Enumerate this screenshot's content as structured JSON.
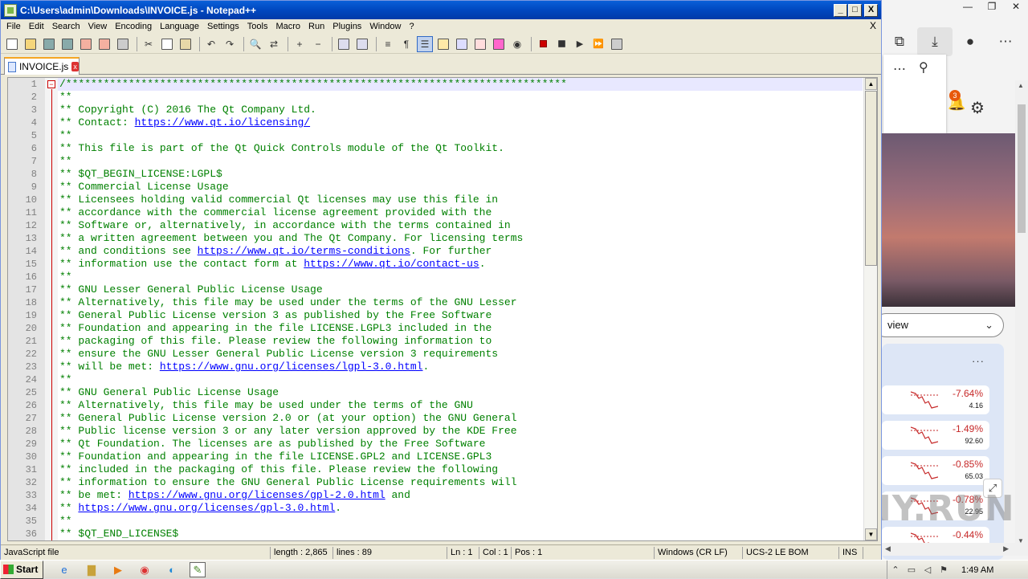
{
  "window": {
    "title": "C:\\Users\\admin\\Downloads\\INVOICE.js - Notepad++",
    "min": "_",
    "max": "□",
    "close": "X"
  },
  "menu": [
    "File",
    "Edit",
    "Search",
    "View",
    "Encoding",
    "Language",
    "Settings",
    "Tools",
    "Macro",
    "Run",
    "Plugins",
    "Window",
    "?"
  ],
  "menu_close": "X",
  "tab": {
    "label": "INVOICE.js",
    "close": "x"
  },
  "editor": {
    "lines": [
      {
        "n": "1",
        "t": "/********************************************************************************"
      },
      {
        "n": "2",
        "t": "**"
      },
      {
        "n": "3",
        "t": "** Copyright (C) 2016 The Qt Company Ltd."
      },
      {
        "n": "4",
        "t": "** Contact: ",
        "link": "https://www.qt.io/licensing/",
        "after": ""
      },
      {
        "n": "5",
        "t": "**"
      },
      {
        "n": "6",
        "t": "** This file is part of the Qt Quick Controls module of the Qt Toolkit."
      },
      {
        "n": "7",
        "t": "**"
      },
      {
        "n": "8",
        "t": "** $QT_BEGIN_LICENSE:LGPL$"
      },
      {
        "n": "9",
        "t": "** Commercial License Usage"
      },
      {
        "n": "10",
        "t": "** Licensees holding valid commercial Qt licenses may use this file in"
      },
      {
        "n": "11",
        "t": "** accordance with the commercial license agreement provided with the"
      },
      {
        "n": "12",
        "t": "** Software or, alternatively, in accordance with the terms contained in"
      },
      {
        "n": "13",
        "t": "** a written agreement between you and The Qt Company. For licensing terms"
      },
      {
        "n": "14",
        "t": "** and conditions see ",
        "link": "https://www.qt.io/terms-conditions",
        "after": ". For further"
      },
      {
        "n": "15",
        "t": "** information use the contact form at ",
        "link": "https://www.qt.io/contact-us",
        "after": "."
      },
      {
        "n": "16",
        "t": "**"
      },
      {
        "n": "17",
        "t": "** GNU Lesser General Public License Usage"
      },
      {
        "n": "18",
        "t": "** Alternatively, this file may be used under the terms of the GNU Lesser"
      },
      {
        "n": "19",
        "t": "** General Public License version 3 as published by the Free Software"
      },
      {
        "n": "20",
        "t": "** Foundation and appearing in the file LICENSE.LGPL3 included in the"
      },
      {
        "n": "21",
        "t": "** packaging of this file. Please review the following information to"
      },
      {
        "n": "22",
        "t": "** ensure the GNU Lesser General Public License version 3 requirements"
      },
      {
        "n": "23",
        "t": "** will be met: ",
        "link": "https://www.gnu.org/licenses/lgpl-3.0.html",
        "after": "."
      },
      {
        "n": "24",
        "t": "**"
      },
      {
        "n": "25",
        "t": "** GNU General Public License Usage"
      },
      {
        "n": "26",
        "t": "** Alternatively, this file may be used under the terms of the GNU"
      },
      {
        "n": "27",
        "t": "** General Public License version 2.0 or (at your option) the GNU General"
      },
      {
        "n": "28",
        "t": "** Public license version 3 or any later version approved by the KDE Free"
      },
      {
        "n": "29",
        "t": "** Qt Foundation. The licenses are as published by the Free Software"
      },
      {
        "n": "30",
        "t": "** Foundation and appearing in the file LICENSE.GPL2 and LICENSE.GPL3"
      },
      {
        "n": "31",
        "t": "** included in the packaging of this file. Please review the following"
      },
      {
        "n": "32",
        "t": "** information to ensure the GNU General Public License requirements will"
      },
      {
        "n": "33",
        "t": "** be met: ",
        "link": "https://www.gnu.org/licenses/gpl-2.0.html",
        "after": " and"
      },
      {
        "n": "34",
        "t": "** ",
        "link": "https://www.gnu.org/licenses/gpl-3.0.html",
        "after": "."
      },
      {
        "n": "35",
        "t": "**"
      },
      {
        "n": "36",
        "t": "** $QT_END_LICENSE$"
      }
    ]
  },
  "status": {
    "filetype": "JavaScript file",
    "length": "length : 2,865",
    "lines": "lines : 89",
    "ln": "Ln : 1",
    "col": "Col : 1",
    "pos": "Pos : 1",
    "eol": "Windows (CR LF)",
    "encoding": "UCS-2 LE BOM",
    "mode": "INS"
  },
  "edge": {
    "notification_count": "3",
    "view_select": "view",
    "stocks": [
      {
        "pct": "-7.64%",
        "val": "4.16"
      },
      {
        "pct": "-1.49%",
        "val": "92.60"
      },
      {
        "pct": "-0.85%",
        "val": "65.03"
      },
      {
        "pct": "-0.78%",
        "val": "22.95"
      },
      {
        "pct": "-0.44%",
        "val": ""
      }
    ],
    "watermark": "ANY.RUN"
  },
  "taskbar": {
    "start": "Start",
    "clock": "1:49 AM"
  }
}
